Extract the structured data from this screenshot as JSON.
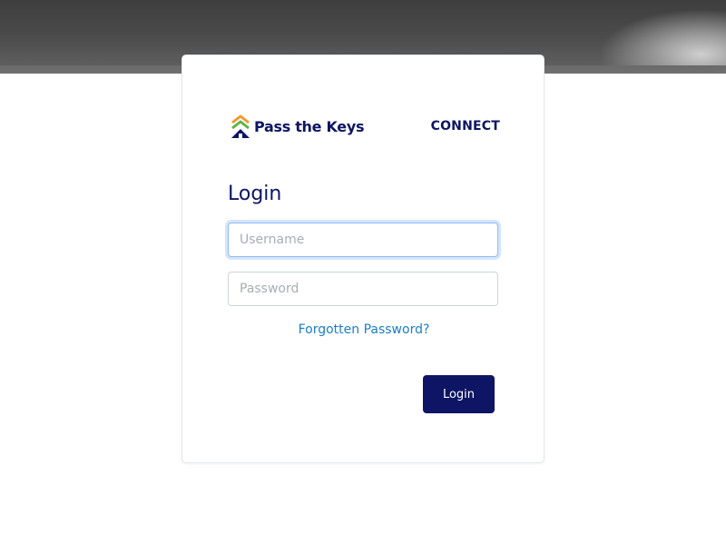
{
  "brand": {
    "logo_text": "Pass the Keys",
    "product_label": "CONNECT",
    "colors": {
      "navy": "#0d1564",
      "green": "#5db544",
      "orange": "#f29a2e",
      "link": "#1a7fc6"
    }
  },
  "login": {
    "title": "Login",
    "username": {
      "value": "",
      "placeholder": "Username"
    },
    "password": {
      "value": "",
      "placeholder": "Password"
    },
    "forgot_link": "Forgotten Password?",
    "submit_label": "Login"
  }
}
